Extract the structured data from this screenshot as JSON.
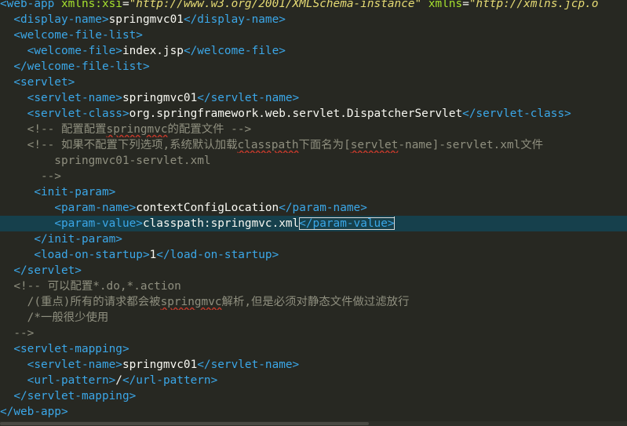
{
  "editor": {
    "current_line_index": 14,
    "lines": [
      {
        "tokens": [
          {
            "t": "tag",
            "v": "<web-app"
          },
          {
            "t": "text",
            "v": " "
          },
          {
            "t": "attr",
            "v": "xmlns:xsi"
          },
          {
            "t": "eq",
            "v": "="
          },
          {
            "t": "str",
            "v": "\"http://www.w3.org/2001/XMLSchema-instance\""
          },
          {
            "t": "text",
            "v": " "
          },
          {
            "t": "attr",
            "v": "xmlns"
          },
          {
            "t": "eq",
            "v": "="
          },
          {
            "t": "str",
            "v": "\"http://xmlns.jcp.o"
          }
        ]
      },
      {
        "tokens": [
          {
            "t": "text",
            "v": "  "
          },
          {
            "t": "tag",
            "v": "<display-name>"
          },
          {
            "t": "text",
            "v": "springmvc01"
          },
          {
            "t": "tag",
            "v": "</display-name>"
          }
        ]
      },
      {
        "tokens": [
          {
            "t": "text",
            "v": "  "
          },
          {
            "t": "tag",
            "v": "<welcome-file-list>"
          }
        ]
      },
      {
        "tokens": [
          {
            "t": "text",
            "v": "    "
          },
          {
            "t": "tag",
            "v": "<welcome-file>"
          },
          {
            "t": "text",
            "v": "index.jsp"
          },
          {
            "t": "tag",
            "v": "</welcome-file>"
          }
        ]
      },
      {
        "tokens": [
          {
            "t": "text",
            "v": "  "
          },
          {
            "t": "tag",
            "v": "</welcome-file-list>"
          }
        ]
      },
      {
        "tokens": [
          {
            "t": "text",
            "v": "  "
          },
          {
            "t": "tag",
            "v": "<servlet>"
          }
        ]
      },
      {
        "tokens": [
          {
            "t": "text",
            "v": "    "
          },
          {
            "t": "tag",
            "v": "<servlet-name>"
          },
          {
            "t": "text",
            "v": "springmvc01"
          },
          {
            "t": "tag",
            "v": "</servlet-name>"
          }
        ]
      },
      {
        "tokens": [
          {
            "t": "text",
            "v": "    "
          },
          {
            "t": "tag",
            "v": "<servlet-class>"
          },
          {
            "t": "text",
            "v": "org.springframework.web.servlet.DispatcherServlet"
          },
          {
            "t": "tag",
            "v": "</servlet-class>"
          }
        ]
      },
      {
        "tokens": [
          {
            "t": "text",
            "v": "    "
          },
          {
            "t": "cmt",
            "v": "<!-- 配置配置"
          },
          {
            "t": "cmt",
            "v": "springmvc",
            "err": true
          },
          {
            "t": "cmt",
            "v": "的配置文件 -->"
          }
        ]
      },
      {
        "tokens": [
          {
            "t": "text",
            "v": "    "
          },
          {
            "t": "cmt",
            "v": "<!-- 如果不配置下列选项,系统默认加载"
          },
          {
            "t": "cmt",
            "v": "classpath",
            "err": true
          },
          {
            "t": "cmt",
            "v": "下面名为["
          },
          {
            "t": "cmt",
            "v": "servlet",
            "err": true
          },
          {
            "t": "cmt",
            "v": "-name]-servlet.xml文件"
          }
        ]
      },
      {
        "tokens": [
          {
            "t": "cmt",
            "v": "        springmvc01-servlet.xml"
          }
        ]
      },
      {
        "tokens": [
          {
            "t": "cmt",
            "v": "      -->"
          }
        ]
      },
      {
        "tokens": [
          {
            "t": "text",
            "v": "     "
          },
          {
            "t": "tag",
            "v": "<init-param>"
          }
        ]
      },
      {
        "tokens": [
          {
            "t": "text",
            "v": "        "
          },
          {
            "t": "tag",
            "v": "<param-name>"
          },
          {
            "t": "text",
            "v": "contextConfigLocation"
          },
          {
            "t": "tag",
            "v": "</param-name>"
          }
        ]
      },
      {
        "caret_after": 3,
        "tokens": [
          {
            "t": "text",
            "v": "        "
          },
          {
            "t": "tag",
            "v": "<param-value>"
          },
          {
            "t": "text",
            "v": "classpath:springmvc.xml"
          },
          {
            "t": "tag",
            "v": "</param-value>"
          }
        ]
      },
      {
        "tokens": [
          {
            "t": "text",
            "v": "     "
          },
          {
            "t": "tag",
            "v": "</init-param>"
          }
        ]
      },
      {
        "tokens": [
          {
            "t": "text",
            "v": "     "
          },
          {
            "t": "tag",
            "v": "<load-on-startup>"
          },
          {
            "t": "text",
            "v": "1"
          },
          {
            "t": "tag",
            "v": "</load-on-startup>"
          }
        ]
      },
      {
        "tokens": [
          {
            "t": "text",
            "v": "  "
          },
          {
            "t": "tag",
            "v": "</servlet>"
          }
        ]
      },
      {
        "tokens": [
          {
            "t": "text",
            "v": "  "
          },
          {
            "t": "cmt",
            "v": "<!-- 可以配置*.do,*.action"
          }
        ]
      },
      {
        "tokens": [
          {
            "t": "cmt",
            "v": "    /(重点)所有的请求都会被"
          },
          {
            "t": "cmt",
            "v": "springmvc",
            "err": true
          },
          {
            "t": "cmt",
            "v": "解析,但是必须对静态文件做过滤放行"
          }
        ]
      },
      {
        "tokens": [
          {
            "t": "cmt",
            "v": "    /*一般很少使用"
          }
        ]
      },
      {
        "tokens": [
          {
            "t": "cmt",
            "v": "  -->"
          }
        ]
      },
      {
        "tokens": [
          {
            "t": "text",
            "v": "  "
          },
          {
            "t": "tag",
            "v": "<servlet-mapping>"
          }
        ]
      },
      {
        "tokens": [
          {
            "t": "text",
            "v": "    "
          },
          {
            "t": "tag",
            "v": "<servlet-name>"
          },
          {
            "t": "text",
            "v": "springmvc01"
          },
          {
            "t": "tag",
            "v": "</servlet-name>"
          }
        ]
      },
      {
        "tokens": [
          {
            "t": "text",
            "v": "    "
          },
          {
            "t": "tag",
            "v": "<url-pattern>"
          },
          {
            "t": "text",
            "v": "/"
          },
          {
            "t": "tag",
            "v": "</url-pattern>"
          }
        ]
      },
      {
        "tokens": [
          {
            "t": "text",
            "v": "  "
          },
          {
            "t": "tag",
            "v": "</servlet-mapping>"
          }
        ]
      },
      {
        "tokens": [
          {
            "t": "tag",
            "v": "</web-app>"
          }
        ]
      }
    ]
  },
  "colors": {
    "background": "#272822",
    "current_line": "#16404c",
    "tag": "#3ba7e8",
    "attribute": "#a6e22e",
    "string": "#e6db74",
    "comment": "#8f8f7f",
    "text": "#f8f8f2",
    "spell_error": "#c0392b"
  }
}
